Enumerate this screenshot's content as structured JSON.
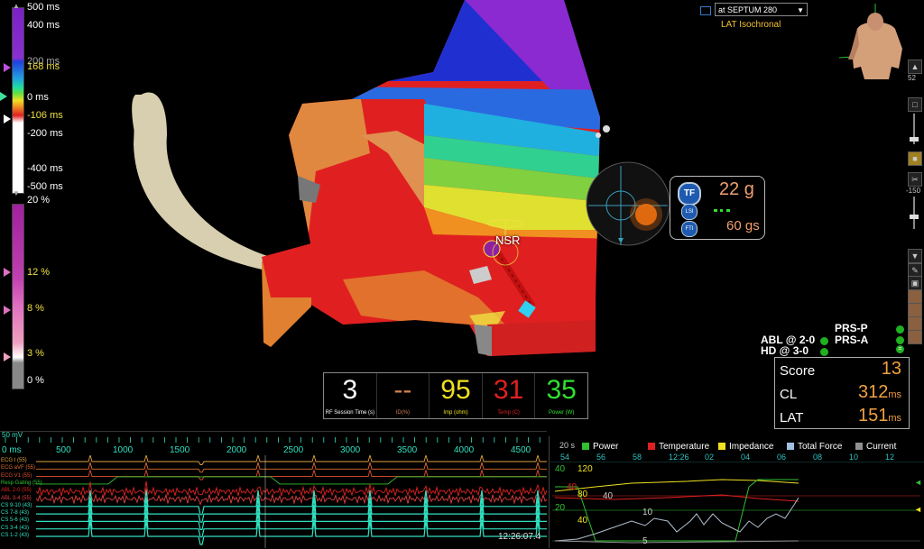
{
  "top_scale": {
    "labels": [
      "500 ms",
      "400 ms",
      "200 ms",
      "168 ms",
      "0 ms",
      "-106 ms",
      "-200 ms",
      "-400 ms",
      "-500 ms"
    ]
  },
  "bottom_scale": {
    "labels": [
      "20 %",
      "12 %",
      "8 %",
      "3 %",
      "0 %"
    ]
  },
  "map_selector": {
    "value": "at SEPTUM 280",
    "subtitle": "LAT Isochronal"
  },
  "side_toolbar": {
    "zoom_value": "52",
    "depth_value": "-150"
  },
  "map_label": "NSR",
  "force_widget": {
    "tf_badge": "TF",
    "lsi_badge": "LSI",
    "fti_badge": "FTI",
    "force": "22 g",
    "fti": "60 gs"
  },
  "rf_panel": {
    "cells": [
      {
        "value": "3",
        "caption": "RF Session Time (s)",
        "color": "#ffffff"
      },
      {
        "value": "--",
        "caption": "ID(%)",
        "color": "#d08050"
      },
      {
        "value": "95",
        "caption": "Imp (ohm)",
        "color": "#f0e020"
      },
      {
        "value": "31",
        "caption": "Temp (C)",
        "color": "#e02020"
      },
      {
        "value": "35",
        "caption": "Power (W)",
        "color": "#30e030"
      }
    ]
  },
  "status": {
    "abl": "ABL @ 2-0",
    "hd": "HD @ 3-0",
    "prs_p": "PRS-P",
    "prs_a": "PRS-A"
  },
  "score_panel": {
    "score_label": "Score",
    "score_value": "13",
    "cl_label": "CL",
    "cl_value": "312",
    "cl_unit": "ms",
    "lat_label": "LAT",
    "lat_value": "151",
    "lat_unit": "ms"
  },
  "ecg": {
    "ruler_start": "0 ms",
    "ruler_ticks": [
      "500",
      "1000",
      "1500",
      "2000",
      "2500",
      "3000",
      "3500",
      "4000",
      "4500"
    ],
    "header_fragment": "50 mV",
    "channels": [
      {
        "label": "ECG I (55)",
        "color": "#e0a040"
      },
      {
        "label": "ECG aVF (55)",
        "color": "#e07030"
      },
      {
        "label": "ECG V1 (55)",
        "color": "#e05030"
      },
      {
        "label": "Resp Gating (55)",
        "color": "#30c030"
      },
      {
        "label": "ABL 2-0 (55)",
        "color": "#e02020"
      },
      {
        "label": "ABL 3-4 (55)",
        "color": "#e04040"
      },
      {
        "label": "CS 9-10 (43)",
        "color": "#30e0c0"
      },
      {
        "label": "CS 7-8 (43)",
        "color": "#30e0c0"
      },
      {
        "label": "CS 5-6 (43)",
        "color": "#30e0c0"
      },
      {
        "label": "CS 3-4 (43)",
        "color": "#30e0c0"
      },
      {
        "label": "CS 1-2 (43)",
        "color": "#30e0c0"
      }
    ],
    "timestamp": "12:26:07.4"
  },
  "trend": {
    "window": "20 s",
    "legend": [
      {
        "label": "Power",
        "color": "#30c030"
      },
      {
        "label": "Temperature",
        "color": "#e02020"
      },
      {
        "label": "Impedance",
        "color": "#f0e020"
      },
      {
        "label": "Total Force",
        "color": "#a0c0e0"
      },
      {
        "label": "Current",
        "color": "#909090"
      }
    ],
    "time_ticks": [
      "54",
      "56",
      "58",
      "12:26",
      "02",
      "04",
      "06",
      "08",
      "10",
      "12"
    ],
    "y_labels_left": [
      "40",
      "40",
      "20",
      "40"
    ],
    "y_labels_mid": [
      "120",
      "80",
      "40"
    ],
    "y_labels_plot": [
      "10",
      "5"
    ]
  }
}
